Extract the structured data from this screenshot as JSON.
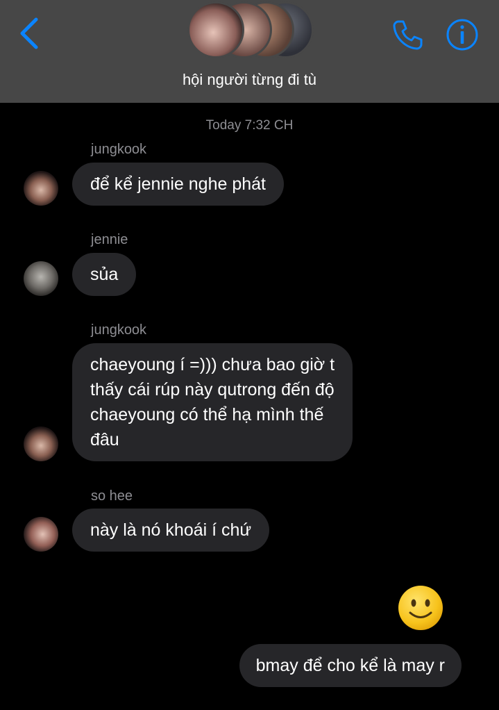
{
  "header": {
    "title": "hội người từng đi tù",
    "back_icon": "chevron-left-icon",
    "call_icon": "phone-icon",
    "info_icon": "info-icon",
    "accent_color": "#0a84ff"
  },
  "thread": {
    "timestamp": "Today 7:32 CH",
    "messages": [
      {
        "sender": "jungkook",
        "text": "để kể jennie nghe phát"
      },
      {
        "sender": "jennie",
        "text": "sủa"
      },
      {
        "sender": "jungkook",
        "lines": [
          "chaeyoung í =))) chưa bao giờ t",
          "thấy cái rúp này qutrong đến độ",
          "chaeyoung có thể hạ mình thế",
          "đâu"
        ]
      },
      {
        "sender": "so hee",
        "text": "này là nó khoái í chứ"
      }
    ],
    "outgoing": {
      "reaction_emoji": "🙂",
      "text": "bmay để cho kể là may r"
    }
  }
}
